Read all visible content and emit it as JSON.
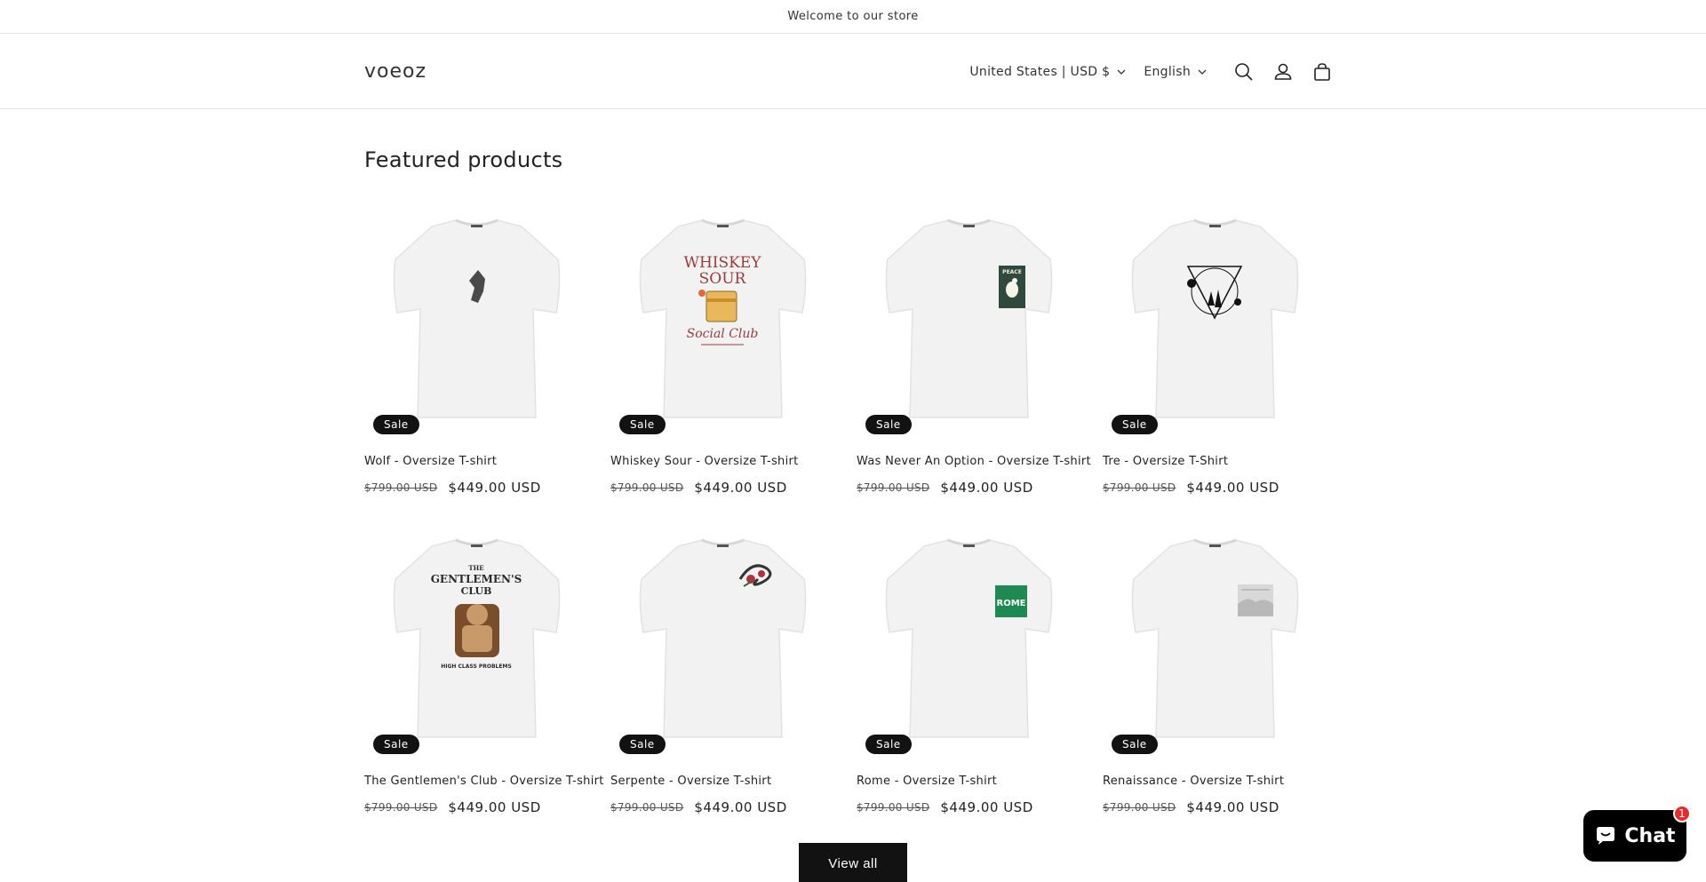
{
  "announcement": "Welcome to our store",
  "header": {
    "logo": "voeoz",
    "country_selector": "United States | USD $",
    "language_selector": "English",
    "icons": [
      "search-icon",
      "account-icon",
      "cart-icon"
    ]
  },
  "section_title": "Featured products",
  "products": [
    {
      "title": "Wolf - Oversize T-shirt",
      "badge": "Sale",
      "compare_price": "$799.00 USD",
      "price": "$449.00 USD"
    },
    {
      "title": "Whiskey Sour - Oversize T-shirt",
      "badge": "Sale",
      "compare_price": "$799.00 USD",
      "price": "$449.00 USD",
      "print_lines": [
        "WHISKEY",
        "SOUR",
        "Social Club"
      ]
    },
    {
      "title": "Was Never An Option - Oversize T-shirt",
      "badge": "Sale",
      "compare_price": "$799.00 USD",
      "price": "$449.00 USD",
      "print_lines": [
        "PEACE"
      ]
    },
    {
      "title": "Tre - Oversize T-Shirt",
      "badge": "Sale",
      "compare_price": "$799.00 USD",
      "price": "$449.00 USD"
    },
    {
      "title": "The Gentlemen's Club - Oversize T-shirt",
      "badge": "Sale",
      "compare_price": "$799.00 USD",
      "price": "$449.00 USD",
      "print_lines": [
        "THE",
        "GENTLEMEN'S",
        "CLUB",
        "HIGH CLASS PROBLEMS"
      ]
    },
    {
      "title": "Serpente - Oversize T-shirt",
      "badge": "Sale",
      "compare_price": "$799.00 USD",
      "price": "$449.00 USD"
    },
    {
      "title": "Rome - Oversize T-shirt",
      "badge": "Sale",
      "compare_price": "$799.00 USD",
      "price": "$449.00 USD",
      "print_lines": [
        "ROME"
      ]
    },
    {
      "title": "Renaissance - Oversize T-shirt",
      "badge": "Sale",
      "compare_price": "$799.00 USD",
      "price": "$449.00 USD"
    }
  ],
  "view_all_label": "View all",
  "chat": {
    "label": "Chat",
    "badge_count": "1"
  },
  "colors": {
    "accent": "#121212",
    "chat_badge": "#e32c2b",
    "rome_green": "#1e8a52"
  }
}
